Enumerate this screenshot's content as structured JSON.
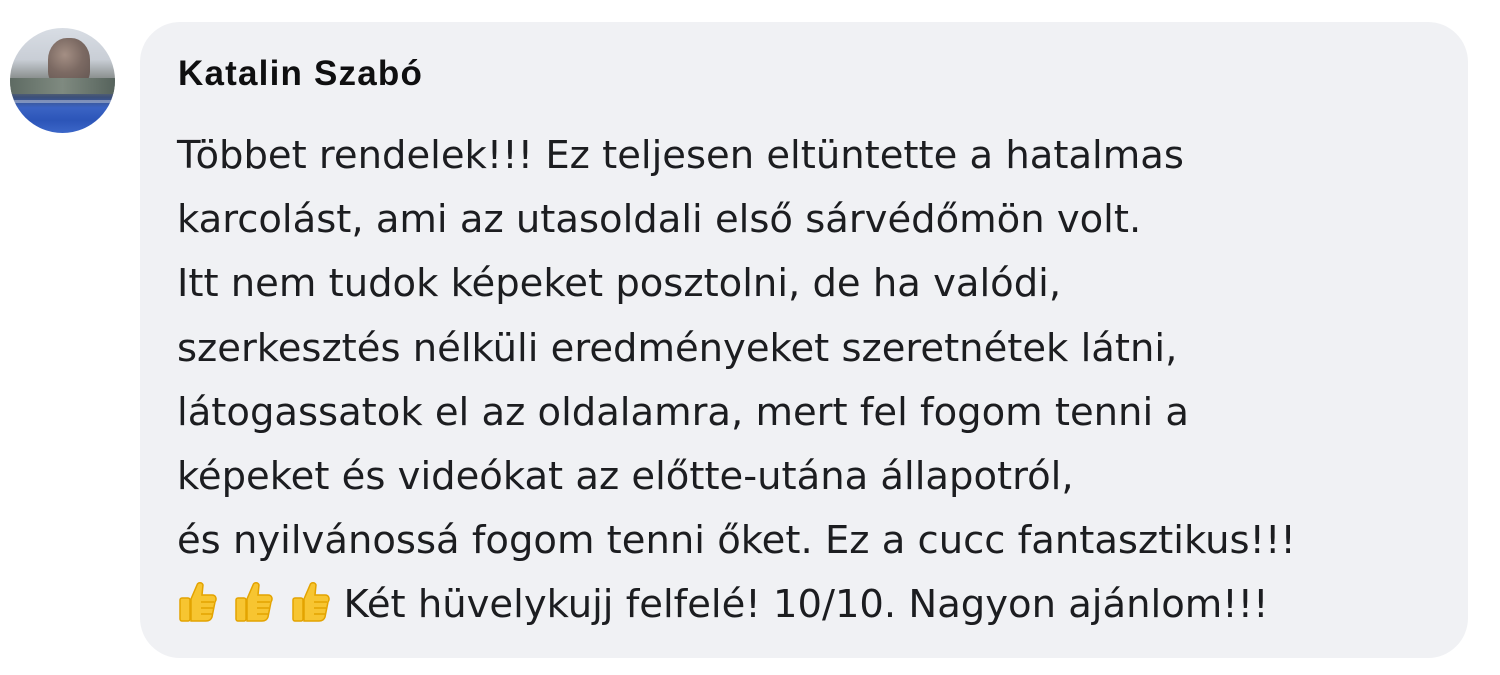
{
  "comment": {
    "author": "Katalin Szabó",
    "lines": [
      "Többet rendelek!!! Ez teljesen eltüntette a hatalmas",
      "karcolást, ami az utasoldali első sárvédőmön volt.",
      "Itt nem tudok képeket posztolni, de ha valódi,",
      "szerkesztés nélküli eredményeket szeretnétek látni,",
      "látogassatok el az oldalamra, mert fel fogom tenni a",
      "képeket és videókat az előtte-utána állapotról,",
      "és nyilvánossá fogom tenni őket. Ez a cucc fantasztikus!!!"
    ],
    "last_line_text": "Két hüvelykujj felfelé! 10/10. Nagyon ajánlom!!!",
    "emoji": [
      "thumbs-up-icon",
      "thumbs-up-icon",
      "thumbs-up-icon"
    ]
  },
  "colors": {
    "bubble": "#f0f1f4",
    "text": "#1c1d20",
    "emoji": "#f7c531"
  }
}
